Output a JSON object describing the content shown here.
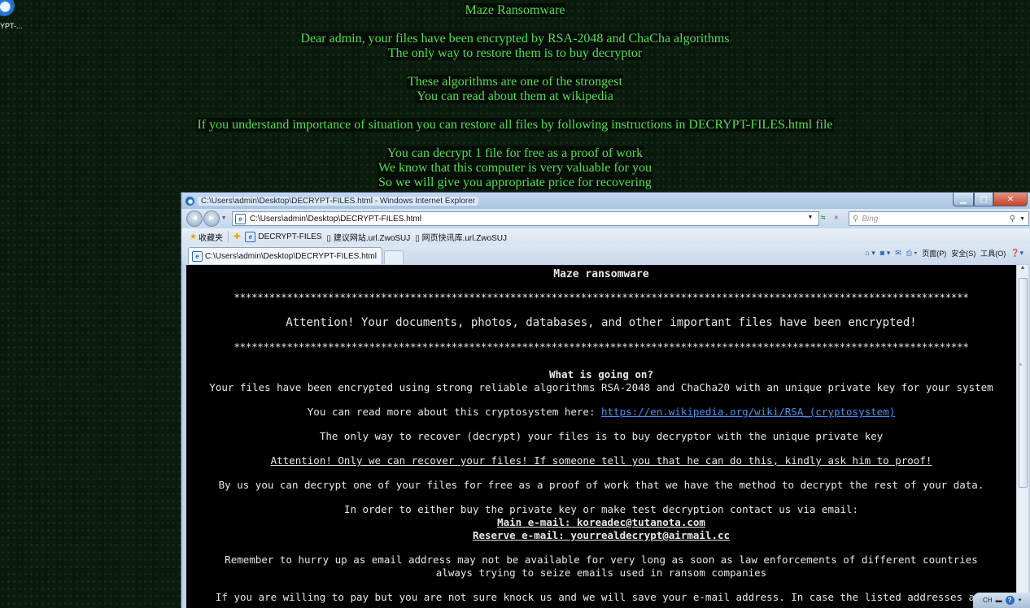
{
  "desktop": {
    "icon_label": "YPT-...",
    "wallpaper_lines": [
      "Maze Ransomware",
      "Dear admin, your files have been encrypted by RSA-2048 and ChaCha algorithms",
      "The only way to restore them is to buy decryptor",
      "These algorithms are one of the strongest",
      "You can read about them at wikipedia",
      "If you understand importance of situation you can restore all files by following instructions in DECRYPT-FILES.html file",
      "You can decrypt 1 file for free as a proof of work",
      "We know that this computer is very valuable for you",
      "So we will give you appropriate price for recovering"
    ]
  },
  "browser": {
    "window_title": "C:\\Users\\admin\\Desktop\\DECRYPT-FILES.html - Windows Internet Explorer",
    "address": "C:\\Users\\admin\\Desktop\\DECRYPT-FILES.html",
    "search_placeholder": "Bing",
    "favorites_label": "收藏夹",
    "favorites_items": [
      "DECRYPT-FILES",
      "建议网站.url.ZwoSUJ",
      "网页快讯库.url.ZwoSUJ"
    ],
    "tab_label": "C:\\Users\\admin\\Desktop\\DECRYPT-FILES.html",
    "commands": [
      "页面(P)",
      "安全(S)",
      "工具(O)"
    ]
  },
  "page": {
    "title": "Maze ransomware",
    "stars": "*****************************************************************************************************************************",
    "attention": "Attention! Your documents, photos, databases, and other important files have been encrypted!",
    "what_heading": "What is going on?",
    "what_text": "Your files have been encrypted using strong reliable algorithms RSA-2048 and ChaCha20 with an unique private key for your system",
    "read_more_prefix": "You can read more about this cryptosystem here: ",
    "read_more_link": "https://en.wikipedia.org/wiki/RSA_(cryptosystem)",
    "only_way": "The only way to recover (decrypt) your files is to buy decryptor with the unique private key",
    "warning": "Attention! Only we can recover your files! If someone tell you that he can do this, kindly ask him to proof!",
    "free_decrypt": "By us you can decrypt one of your files for free as a proof of work that we have the method to decrypt the rest of your data.",
    "contact_intro": "In order to either buy the private key or make test decryption contact us via email:",
    "main_email": "Main e-mail: koreadec@tutanota.com",
    "reserve_email": "Reserve e-mail: yourrealdecrypt@airmail.cc",
    "hurry_1": "Remember to hurry up as email address may not be available for very long as soon as law enforcements of different countries",
    "hurry_2": "always trying to seize emails used in ransom companies",
    "willing": "If you are willing to pay but you are not sure knock us and we will save your e-mail address. In case the listed addresses are"
  },
  "tray": {
    "lang": "CH"
  }
}
